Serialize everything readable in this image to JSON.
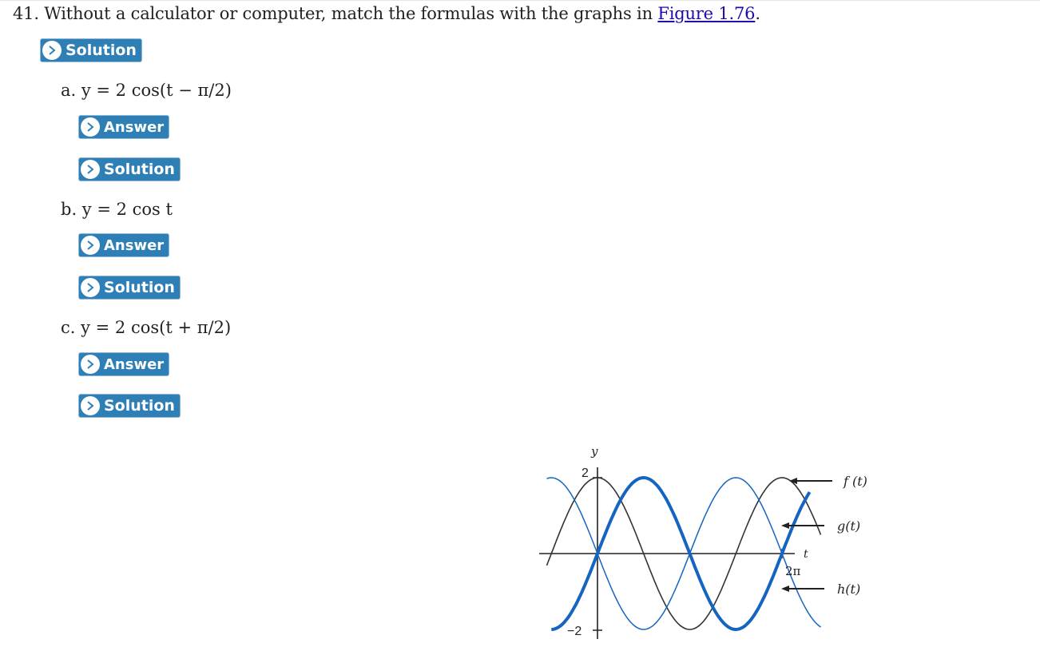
{
  "question": {
    "text": "41. Without a calculator or computer, match the formulas with the graphs in ",
    "link": "Figure 1.76",
    "tail": "."
  },
  "solution_button": "Solution",
  "parts": [
    {
      "prefix": "a. ",
      "formula": "y = 2 cos(t − π/2)",
      "answer_label": "Answer",
      "solution_label": "Solution"
    },
    {
      "prefix": "b. ",
      "formula": "y = 2 cos t",
      "answer_label": "Answer",
      "solution_label": "Solution"
    },
    {
      "prefix": "c. ",
      "formula": "y = 2 cos(t + π/2)",
      "answer_label": "Answer",
      "solution_label": "Solution"
    }
  ],
  "figure": {
    "y_axis_label": "y",
    "t_axis_label": "t",
    "y_max_label": "2",
    "y_min_label": "−2",
    "t_end_label": "2π",
    "curve_labels": [
      "f (t)",
      "g(t)",
      "h(t)"
    ]
  },
  "colors": {
    "button": "#2d7fb5",
    "link": "#1a0dab",
    "curve_blue": "#1565c0",
    "curve_dark": "#333333"
  }
}
